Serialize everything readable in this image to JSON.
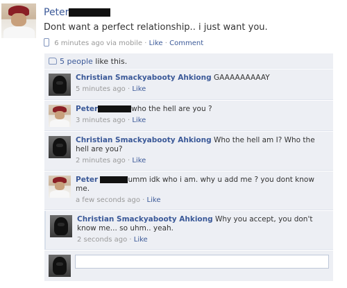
{
  "post": {
    "author": "Peter",
    "text": "Dont want a perfect relationship.. i just want you.",
    "time": "6 minutes ago via mobile",
    "like_link": "Like",
    "comment_link": "Comment",
    "separator": "·",
    "icon": "mobile-phone-icon"
  },
  "likes": {
    "count_text": "5 people",
    "suffix": " like this.",
    "icon": "thumbs-up-icon"
  },
  "comments": [
    {
      "author": "Christian Smackyabooty Ahkiong",
      "text": "GAAAAAAAAAY",
      "time": "5 minutes ago",
      "like": "Like",
      "avatar": "christian"
    },
    {
      "author": "Peter",
      "text": "who the hell are you ?",
      "time": "3 minutes ago",
      "like": "Like",
      "avatar": "peter"
    },
    {
      "author": "Christian Smackyabooty Ahkiong",
      "text": "Who the hell am I? Who the hell are you?",
      "time": "2 minutes ago",
      "like": "Like",
      "avatar": "christian"
    },
    {
      "author": "Peter",
      "text": "umm idk who i am. why u add me ? you dont know me.",
      "time": "a few seconds ago",
      "like": "Like",
      "avatar": "peter"
    },
    {
      "author": "Christian Smackyabooty Ahkiong",
      "text": "Why you accept, you don't know me... so uhm.. yeah.",
      "time": "2 seconds ago",
      "like": "Like",
      "avatar": "christian"
    }
  ],
  "composer": {
    "placeholder": ""
  },
  "colors": {
    "link": "#3b5998",
    "feedback_bg": "#edeff4",
    "meta": "#999999"
  }
}
